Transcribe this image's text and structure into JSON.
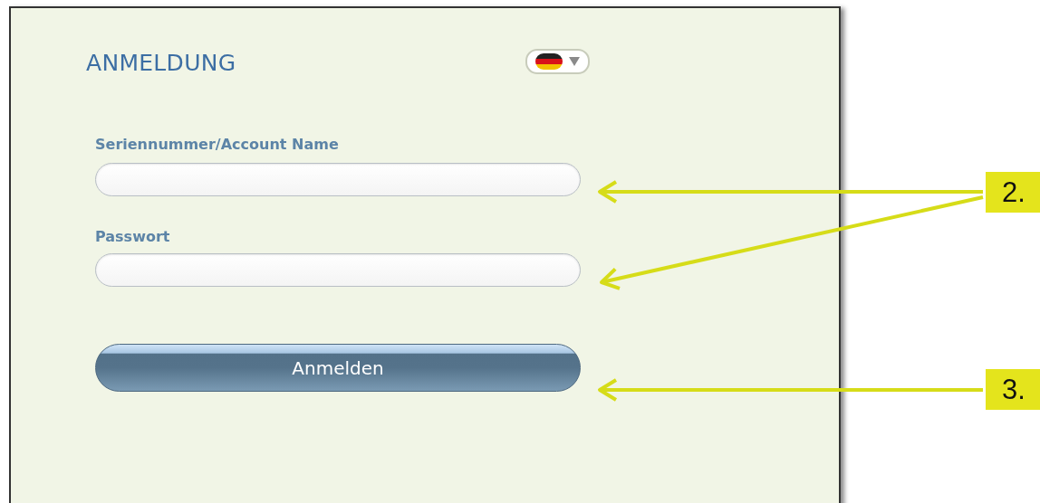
{
  "login": {
    "title": "ANMELDUNG",
    "fields": [
      {
        "label": "Seriennummer/Account Name"
      },
      {
        "label": "Passwort"
      }
    ],
    "button": "Anmelden"
  },
  "callouts": [
    {
      "label": "2.",
      "kind": "fields"
    },
    {
      "label": "3.",
      "kind": "button"
    }
  ]
}
